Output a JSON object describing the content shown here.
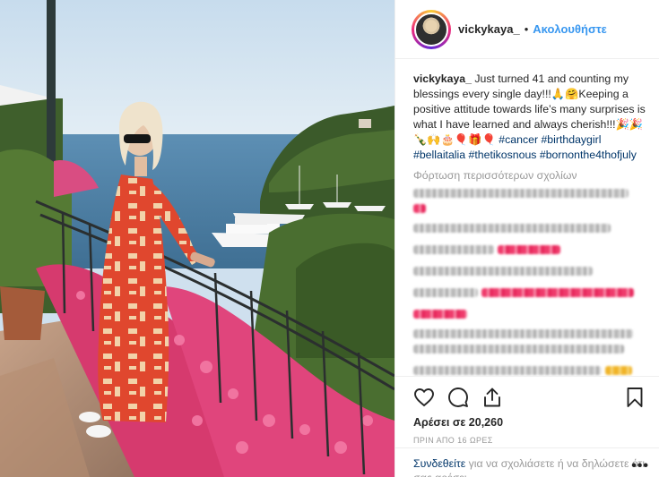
{
  "header": {
    "username": "vickykaya_",
    "separator": "•",
    "follow_label": "Ακολουθήστε"
  },
  "caption": {
    "username": "vickykaya_",
    "text": "Just turned 41 and counting my blessings every single day!!!🙏🤗Keeping a positive attitude towards life’s many surprises is what I have learned and always cherish!!!🎉🎉🍾🙌🎂🎈🎁🎈",
    "hashtags": [
      "#cancer",
      "#birthdaygirl",
      "#bellaitalia",
      "#thetikosnous",
      "#bornonthe4thofjuly"
    ]
  },
  "load_more_label": "Φόρτωση περισσότερων σχολίων",
  "actions": {
    "like_icon": "heart-outline-icon",
    "comment_icon": "comment-bubble-icon",
    "share_icon": "share-upload-icon",
    "save_icon": "bookmark-icon",
    "likes_text": "Αρέσει σε 20,260",
    "timestamp": "ΠΡΙΝ ΑΠΟ 16 ΩΡΕΣ"
  },
  "login": {
    "link_label": "Συνδεθείτε",
    "rest_text": " για να σχολιάσετε ή να δηλώσετε ότι σας αρέσει.",
    "more_label": "•••"
  },
  "colors": {
    "link_blue": "#3897f0",
    "hashtag_navy": "#003569",
    "muted_gray": "#999999"
  }
}
